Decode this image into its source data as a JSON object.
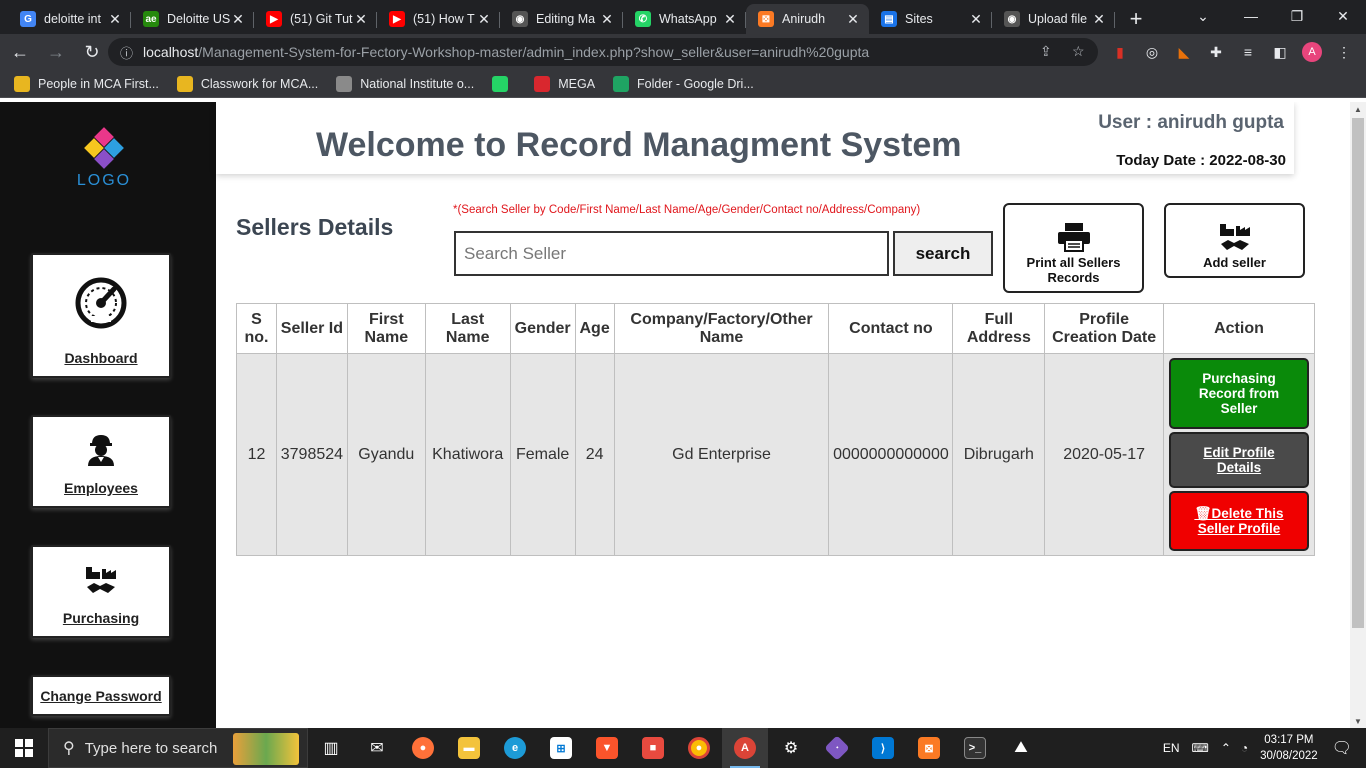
{
  "browser": {
    "tabs": [
      {
        "title": "deloitte int",
        "fav_color": "#4285f4",
        "fav_text": "G"
      },
      {
        "title": "Deloitte US",
        "fav_color": "#26890d",
        "fav_text": "ae"
      },
      {
        "title": "(51) Git Tut",
        "fav_color": "#ff0000",
        "fav_text": "▶"
      },
      {
        "title": "(51) How T",
        "fav_color": "#ff0000",
        "fav_text": "▶"
      },
      {
        "title": "Editing Ma",
        "fav_color": "#555555",
        "fav_text": "◉"
      },
      {
        "title": "WhatsApp",
        "fav_color": "#25d366",
        "fav_text": "✆"
      },
      {
        "title": "Anirudh",
        "fav_color": "#fb7a24",
        "fav_text": "⊠",
        "active": true
      },
      {
        "title": "Sites",
        "fav_color": "#1a73e8",
        "fav_text": "▤"
      },
      {
        "title": "Upload file",
        "fav_color": "#555555",
        "fav_text": "◉"
      }
    ],
    "new_tab": "+",
    "url_host": "localhost",
    "url_path": "/Management-System-for-Fectory-Workshop-master/admin_index.php?show_seller&user=anirudh%20gupta",
    "profile_initial": "A",
    "bookmarks": [
      {
        "label": "People in MCA First...",
        "fav_color": "#e8b620"
      },
      {
        "label": "Classwork for MCA...",
        "fav_color": "#e8b620"
      },
      {
        "label": "National Institute o...",
        "fav_color": "#8a8a8a"
      },
      {
        "label": "",
        "fav_color": "#25d366"
      },
      {
        "label": "MEGA",
        "fav_color": "#d9272e"
      },
      {
        "label": "Folder - Google Dri...",
        "fav_color": "#1fa463"
      }
    ]
  },
  "sidebar": {
    "logo_text": "LOGO",
    "items": [
      {
        "label": "Dashboard",
        "icon": "speedometer-icon"
      },
      {
        "label": "Employees",
        "icon": "worker-icon"
      },
      {
        "label": "Purchasing",
        "icon": "factory-handshake-icon"
      }
    ],
    "change_password": "Change Password"
  },
  "header": {
    "title": "Welcome to Record Managment System",
    "user": "User : anirudh gupta",
    "date": "Today Date : 2022-08-30"
  },
  "main": {
    "section_title": "Sellers Details",
    "search_hint": "*(Search Seller by Code/First Name/Last Name/Age/Gender/Contact no/Address/Company)",
    "search_placeholder": "Search Seller",
    "search_button": "search",
    "print_button": "Print all Sellers Records",
    "add_button": "Add seller"
  },
  "table": {
    "headers": [
      "S no.",
      "Seller Id",
      "First Name",
      "Last Name",
      "Gender",
      "Age",
      "Company/Factory/Other Name",
      "Contact no",
      "Full Address",
      "Profile Creation Date",
      "Action"
    ],
    "rows": [
      [
        "12",
        "3798524",
        "Gyandu",
        "Khatiwora",
        "Female",
        "24",
        "Gd Enterprise",
        "0000000000000",
        "Dibrugarh",
        "2020-05-17"
      ]
    ],
    "actions": {
      "purchase": "Purchasing Record from Seller",
      "edit": "Edit Profile Details",
      "delete": "Delete This Seller Profile"
    }
  },
  "taskbar": {
    "search_placeholder": "Type here to search",
    "lang": "EN",
    "time": "03:17 PM",
    "date": "30/08/2022"
  }
}
